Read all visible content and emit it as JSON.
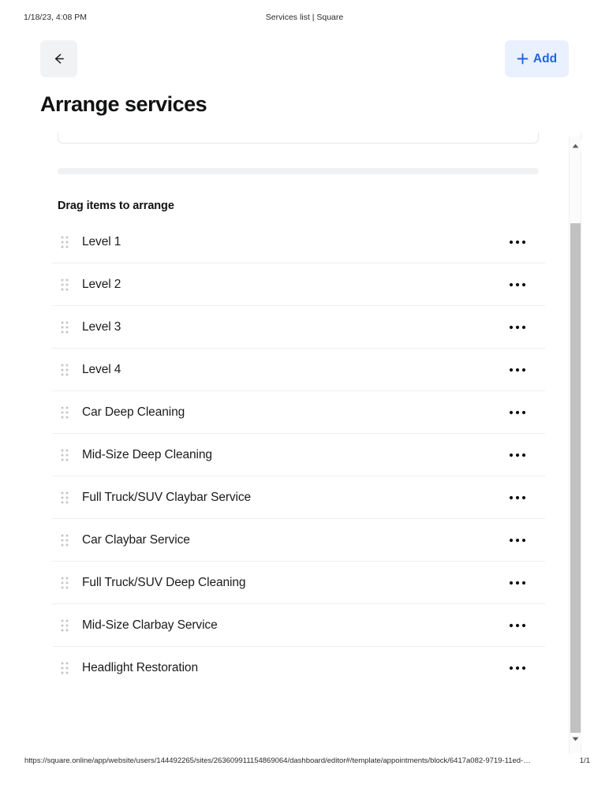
{
  "print_header": {
    "date": "1/18/23, 4:08 PM",
    "title": "Services list | Square"
  },
  "topbar": {
    "back_icon": "arrow-left-icon",
    "add_icon": "plus-icon",
    "add_label": "Add"
  },
  "page_title": "Arrange services",
  "section": {
    "heading": "Drag items to arrange"
  },
  "items": [
    {
      "label": "Level 1",
      "handle_icon": "drag-handle-icon",
      "menu_icon": "more-options-icon"
    },
    {
      "label": "Level 2",
      "handle_icon": "drag-handle-icon",
      "menu_icon": "more-options-icon"
    },
    {
      "label": "Level 3",
      "handle_icon": "drag-handle-icon",
      "menu_icon": "more-options-icon"
    },
    {
      "label": "Level 4",
      "handle_icon": "drag-handle-icon",
      "menu_icon": "more-options-icon"
    },
    {
      "label": "Car Deep Cleaning",
      "handle_icon": "drag-handle-icon",
      "menu_icon": "more-options-icon"
    },
    {
      "label": "Mid-Size Deep Cleaning",
      "handle_icon": "drag-handle-icon",
      "menu_icon": "more-options-icon"
    },
    {
      "label": "Full Truck/SUV Claybar Service",
      "handle_icon": "drag-handle-icon",
      "menu_icon": "more-options-icon"
    },
    {
      "label": "Car Claybar Service",
      "handle_icon": "drag-handle-icon",
      "menu_icon": "more-options-icon"
    },
    {
      "label": "Full Truck/SUV Deep Cleaning",
      "handle_icon": "drag-handle-icon",
      "menu_icon": "more-options-icon"
    },
    {
      "label": "Mid-Size Clarbay Service",
      "handle_icon": "drag-handle-icon",
      "menu_icon": "more-options-icon"
    },
    {
      "label": "Headlight Restoration",
      "handle_icon": "drag-handle-icon",
      "menu_icon": "more-options-icon"
    }
  ],
  "scrollbar": {
    "up_icon": "caret-up-icon",
    "down_icon": "caret-down-icon"
  },
  "footer": {
    "url": "https://square.online/app/website/users/144492265/sites/263609911154869064/dashboard/editor#/template/appointments/block/6417a082-9719-11ed-…",
    "page": "1/1"
  },
  "colors": {
    "accent_blue": "#2066dd",
    "accent_blue_bg": "#e9f0fe",
    "back_btn_bg": "#f1f2f3",
    "text_primary": "#111213",
    "divider": "#eef0f1",
    "progress_bar": "#f0f1f3",
    "scrollbar_thumb": "#c1c1c1"
  }
}
